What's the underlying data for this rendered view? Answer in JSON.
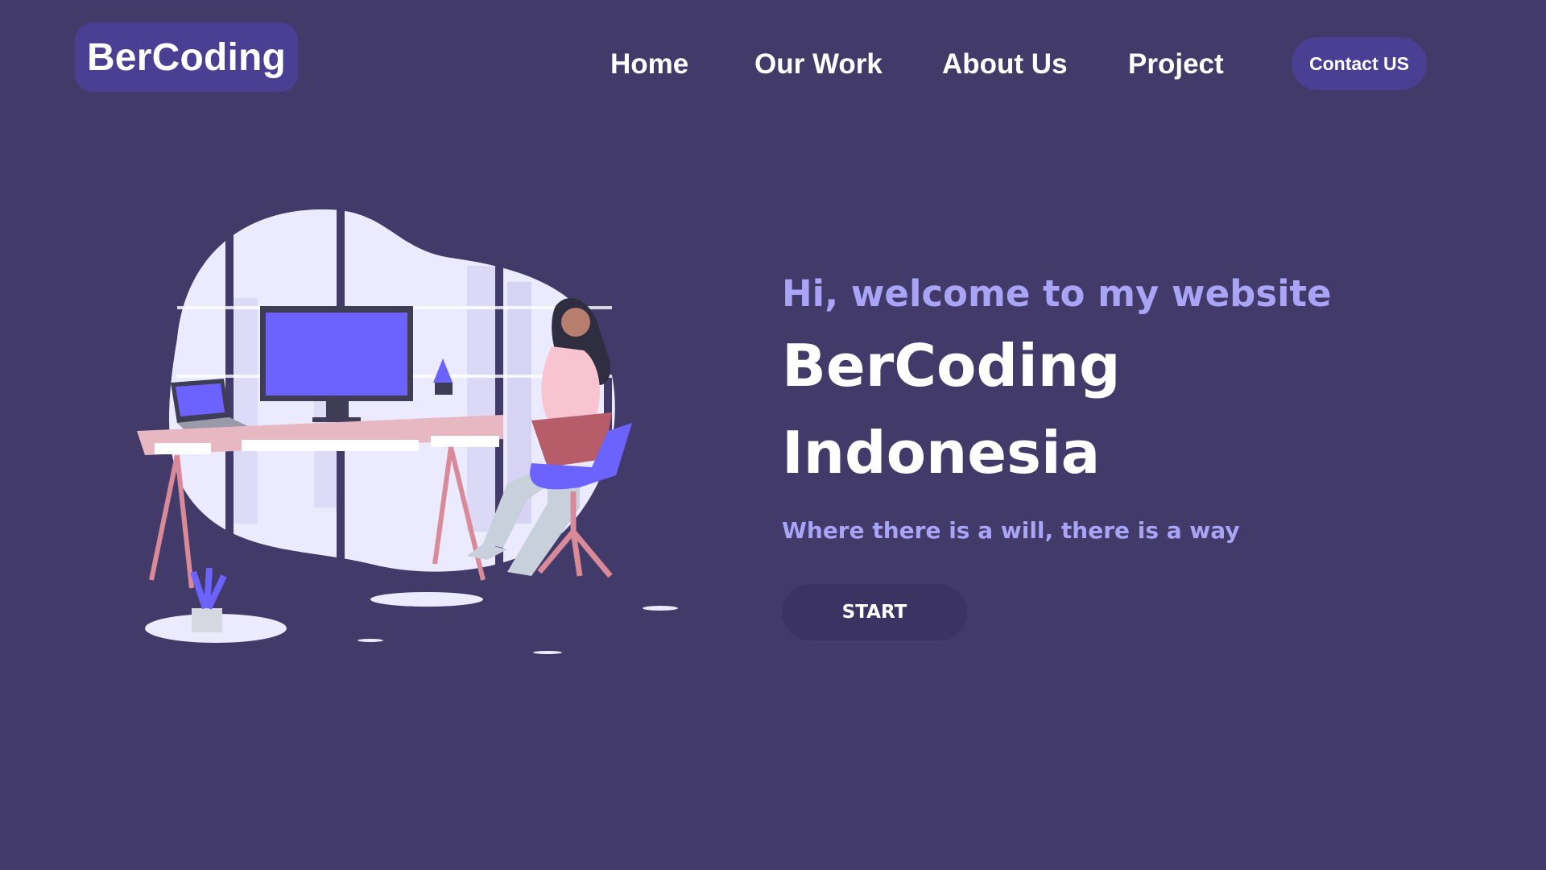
{
  "brand": {
    "logo_text": "BerCoding"
  },
  "nav": {
    "items": [
      {
        "label": "Home"
      },
      {
        "label": "Our Work"
      },
      {
        "label": "About Us"
      },
      {
        "label": "Project"
      }
    ],
    "contact_label": "Contact US"
  },
  "hero": {
    "greeting": "Hi, welcome to my website",
    "title_line1": "BerCoding",
    "title_line2": "Indonesia",
    "tagline": "Where there is a will, there is a way",
    "cta_label": "START"
  },
  "colors": {
    "background": "#423a69",
    "accent": "#4a3f93",
    "highlight_text": "#a9a4f6",
    "illustration_purple": "#6c63ff",
    "desk_pink": "#e6a8b4"
  }
}
